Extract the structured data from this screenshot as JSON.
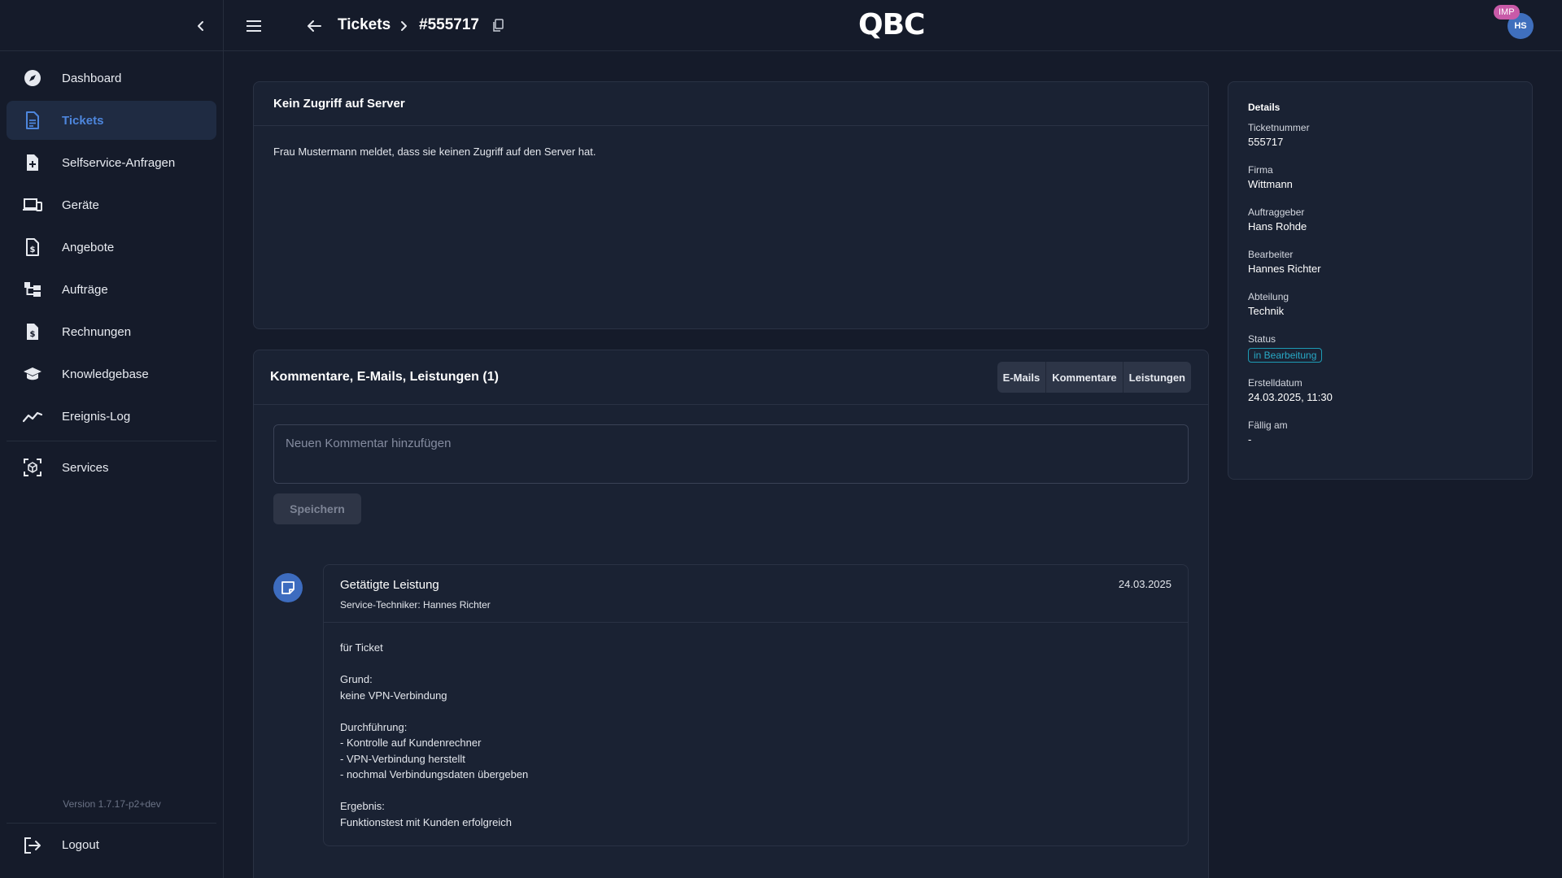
{
  "app": {
    "logo": "QBC",
    "version": "Version 1.7.17-p2+dev"
  },
  "sidebar": {
    "items": [
      {
        "label": "Dashboard",
        "icon": "compass-icon",
        "active": false
      },
      {
        "label": "Tickets",
        "icon": "document-icon",
        "active": true
      },
      {
        "label": "Selfservice-Anfragen",
        "icon": "document-plus-icon",
        "active": false
      },
      {
        "label": "Geräte",
        "icon": "devices-icon",
        "active": false
      },
      {
        "label": "Angebote",
        "icon": "document-dollar-icon",
        "active": false
      },
      {
        "label": "Aufträge",
        "icon": "hierarchy-icon",
        "active": false
      },
      {
        "label": "Rechnungen",
        "icon": "invoice-icon",
        "active": false
      },
      {
        "label": "Knowledgebase",
        "icon": "graduation-cap-icon",
        "active": false
      },
      {
        "label": "Ereignis-Log",
        "icon": "trend-line-icon",
        "active": false
      }
    ],
    "services": {
      "label": "Services",
      "icon": "cube-scan-icon"
    },
    "logout": {
      "label": "Logout",
      "icon": "logout-icon"
    }
  },
  "topbar": {
    "breadcrumb_tickets": "Tickets",
    "breadcrumb_id": "#555717",
    "user_initials": "HS",
    "impersonation_badge": "IMP"
  },
  "ticket": {
    "title": "Kein Zugriff auf Server",
    "description": "Frau Mustermann meldet, dass sie keinen Zugriff auf den Server hat."
  },
  "comments": {
    "title": "Kommentare, E-Mails, Leistungen (1)",
    "filters": [
      "E-Mails",
      "Kommentare",
      "Leistungen"
    ],
    "input_placeholder": "Neuen Kommentar hinzufügen",
    "save_label": "Speichern",
    "entries": [
      {
        "title": "Getätigte Leistung",
        "subtitle": "Service-Techniker: Hannes Richter",
        "date": "24.03.2025",
        "body_lines": [
          "für Ticket",
          "",
          "Grund:",
          "keine VPN-Verbindung",
          "",
          "Durchführung:",
          "- Kontrolle auf Kundenrechner",
          "- VPN-Verbindung herstellt",
          "- nochmal Verbindungsdaten übergeben",
          "",
          "Ergebnis:",
          "Funktionstest mit Kunden erfolgreich"
        ]
      }
    ]
  },
  "details": {
    "title": "Details",
    "fields": [
      {
        "label": "Ticketnummer",
        "value": "555717"
      },
      {
        "label": "Firma",
        "value": "Wittmann"
      },
      {
        "label": "Auftraggeber",
        "value": "Hans Rohde"
      },
      {
        "label": "Bearbeiter",
        "value": "Hannes Richter"
      },
      {
        "label": "Abteilung",
        "value": "Technik"
      }
    ],
    "status": {
      "label": "Status",
      "value": "in Bearbeitung",
      "color": "#28a9c6"
    },
    "fields_after": [
      {
        "label": "Erstelldatum",
        "value": "24.03.2025, 11:30"
      },
      {
        "label": "Fällig am",
        "value": "-"
      }
    ]
  },
  "colors": {
    "accent": "#4d86dd",
    "background": "#151b2a",
    "card": "#1a2233",
    "status": "#28a9c6",
    "imp_badge": "#c85aa8"
  }
}
